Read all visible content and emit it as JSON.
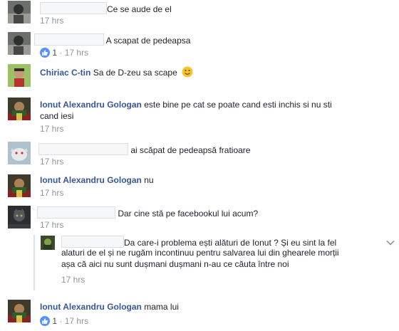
{
  "comments": [
    {
      "author": "",
      "text": "Ce se aude de el",
      "time": "17 hrs"
    },
    {
      "author": "",
      "text": "A scapat de pedeapsa",
      "likes": "1",
      "separator": "·",
      "time": "17 hrs"
    },
    {
      "author": "Chiriac C-tin",
      "text": "Sa de D-zeu sa scape",
      "emoji": "smiley-icon"
    },
    {
      "author": "Ionut Alexandru Gologan",
      "text_line1": "este bine pe cat se poate cand esti inchis si nu sti",
      "text_line2": "cand iesi",
      "time": "17 hrs"
    },
    {
      "author": "",
      "text": "ai scăpat de pedeapsă fratioare",
      "time": "17 hrs"
    },
    {
      "author": "Ionut Alexandru Gologan",
      "text": "nu",
      "time": "17 hrs"
    },
    {
      "author": "",
      "text": "Dar cine stă pe facebookul lui acum?",
      "time": "17 hrs"
    },
    {
      "author": "",
      "text_line1": "Da care-i problema ești alături de Ionut ? Și eu sint la fel",
      "text_line2": "alaturi de el și ne rugăm incontinuu pentru salvarea lui din ghearele morții",
      "text_line3": "așa că aici nu sunt dușmani dușmani n-au ce căuta între noi",
      "time": "17 hrs"
    },
    {
      "author": "Ionut Alexandru Gologan",
      "text": "mama lui",
      "likes": "1",
      "separator": "·",
      "time": "17 hrs"
    }
  ],
  "colors": {
    "link": "#365899",
    "meta": "#90949c",
    "like_badge": "#5890ff",
    "text": "#1d2129"
  },
  "icons": [
    "like-icon",
    "smiley-icon",
    "chevron-down-icon"
  ]
}
